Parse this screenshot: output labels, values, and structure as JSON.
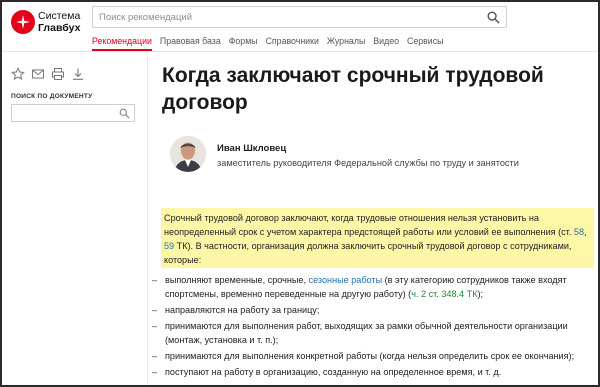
{
  "header": {
    "brand_line1": "Система",
    "brand_line2": "Главбух",
    "search_placeholder": "Поиск рекомендаций"
  },
  "nav": {
    "items": [
      "Рекомендации",
      "Правовая база",
      "Формы",
      "Справочники",
      "Журналы",
      "Видео",
      "Сервисы"
    ],
    "active_index": 0
  },
  "sidebar": {
    "tools": [
      "star-icon",
      "email-icon",
      "print-icon",
      "download-icon"
    ],
    "doc_search_label": "ПОИСК ПО ДОКУМЕНТУ",
    "doc_search_value": ""
  },
  "article": {
    "title": "Когда заключают срочный трудовой договор",
    "author": {
      "name": "Иван Шкловец",
      "role": "заместитель руководителя Федеральной службы по труду и занятости"
    },
    "lead": {
      "text_1": "Срочный трудовой договор заключают, когда трудовые отношения нельзя установить на неопределенный срок с учетом характера предстоящей работы или условий ее выполнения (ст. ",
      "link_1": "58",
      "text_2": ", ",
      "link_2": "59",
      "text_3": " ТК). В частности, организация должна заключить срочный трудовой договор с сотрудниками, которые:"
    },
    "bullets": {
      "b1_text_1": "выполняют временные, срочные, ",
      "b1_link": "сезонные работы",
      "b1_text_2": " (в эту категорию сотрудников также входят спортсмены, временно переведенные на другую работу) (",
      "b1_ref": "ч. 2 ст. 348.4 ТК",
      "b1_text_3": ");",
      "b2": "направляются на работу за границу;",
      "b3": "принимаются для выполнения работ, выходящих за рамки обычной деятельности организации (монтаж, установка и т. п.);",
      "b4": "принимаются для выполнения конкретной работы (когда нельзя определить срок ее окончания);",
      "b5": "поступают на работу в организацию, созданную на определенное время, и т. д."
    }
  },
  "colors": {
    "accent": "#e3001b",
    "link": "#1f6fb2",
    "ref_green": "#1a8a3a",
    "highlight": "#fbf7a6"
  }
}
